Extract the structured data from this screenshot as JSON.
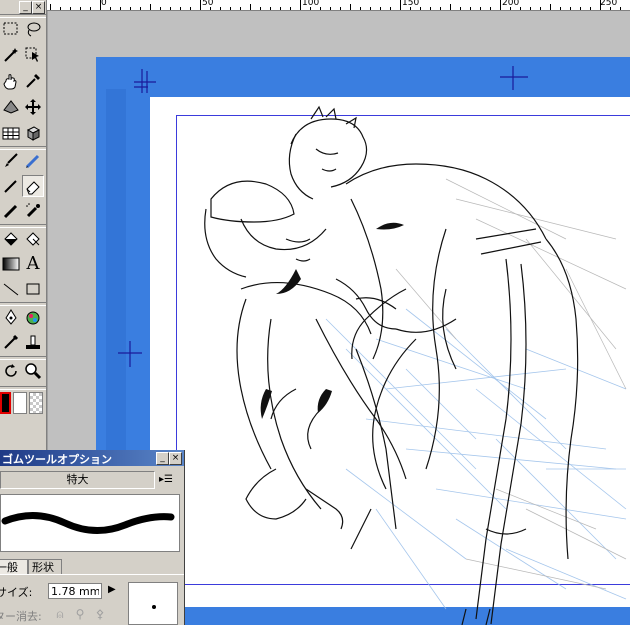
{
  "toolbox": {
    "minimize_glyph": "_",
    "close_glyph": "×",
    "tools": [
      "rect-select",
      "lasso",
      "magic-wand",
      "select-layer",
      "hand",
      "eyedropper",
      "gradient",
      "move",
      "table",
      "cube",
      "brush",
      "pen",
      "pencil",
      "eraser",
      "marker",
      "airbrush",
      "fill",
      "fill-select",
      "dither",
      "text",
      "line",
      "rectangle",
      "pen-tool",
      "color-mixer",
      "stamp",
      "stamp-2",
      "rotate",
      "zoom"
    ],
    "text_tool_glyph": "A"
  },
  "ruler": {
    "marks": [
      "0",
      "50",
      "100",
      "150",
      "200",
      "250"
    ]
  },
  "palette": {
    "title": "ムツールオプション",
    "title_prefix": "ゴ",
    "minimize_glyph": "_",
    "close_glyph": "×",
    "brush_size_label": "特大",
    "menu_glyph": "▸☰",
    "tabs": [
      "一般",
      "形状"
    ],
    "size_label": "サイズ:",
    "size_value": "1.78 mm",
    "size_arrow": "▶",
    "vector_erase_label": "ター消去:",
    "icons": [
      "eraser-a-icon",
      "eraser-b-icon",
      "eraser-c-icon"
    ],
    "icon_glyphs": [
      "⍝",
      "⚲",
      "⚴"
    ]
  },
  "colors": {
    "page_blue": "#3a7ee0",
    "frame_line": "#3b3bdc",
    "palette_title": "#1f3a86",
    "ui_gray": "#d4d0c8",
    "fg_swatch_border": "#e00000"
  }
}
